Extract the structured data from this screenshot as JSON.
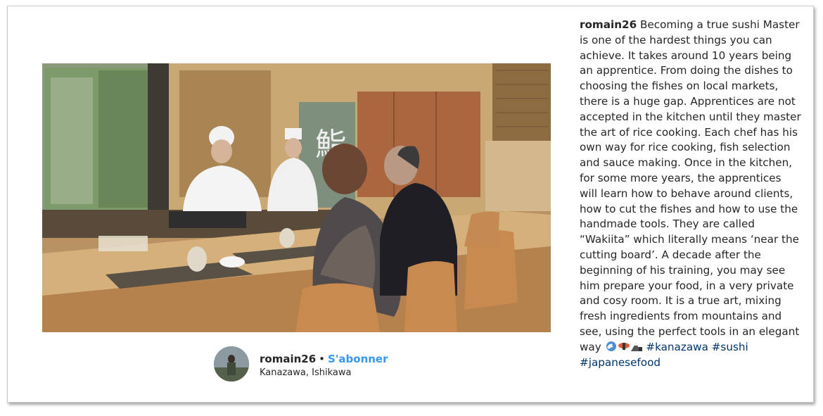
{
  "post": {
    "author": "romain26",
    "separator": "•",
    "subscribe_label": "S'abonner",
    "location": "Kanazawa, Ishikawa"
  },
  "caption": {
    "username": "romain26",
    "text": "Becoming a true sushi Master is one of the hardest things you can achieve. It takes around 10 years being an apprentice. From doing the dishes to choosing the fishes on local markets, there is a huge gap. Apprentices are not accepted in the kitchen until they master the art of rice cooking. Each chef has his own way for rice cooking, fish selection and sauce making. Once in the kitchen, for some more years, the apprentices will learn how to behave around clients, how to cut the fishes and how to use the handmade tools. They are called “Wakiita” which literally means ‘near the cutting board’. A decade after the beginning of his training, you may see him prepare your food, in a very private and cosy room. It is a true art, mixing fresh ingredients from mountains and see, using the perfect tools in an elegant way",
    "emojis": [
      "wave-emoji",
      "sushi-emoji",
      "mountain-emoji"
    ],
    "hashtags": [
      "#kanazawa",
      "#sushi",
      "#japanesefood"
    ]
  },
  "icons": {
    "next": "chevron-right-icon"
  },
  "colors": {
    "link_blue": "#3897f0",
    "hashtag": "#003569",
    "text": "#262626"
  }
}
